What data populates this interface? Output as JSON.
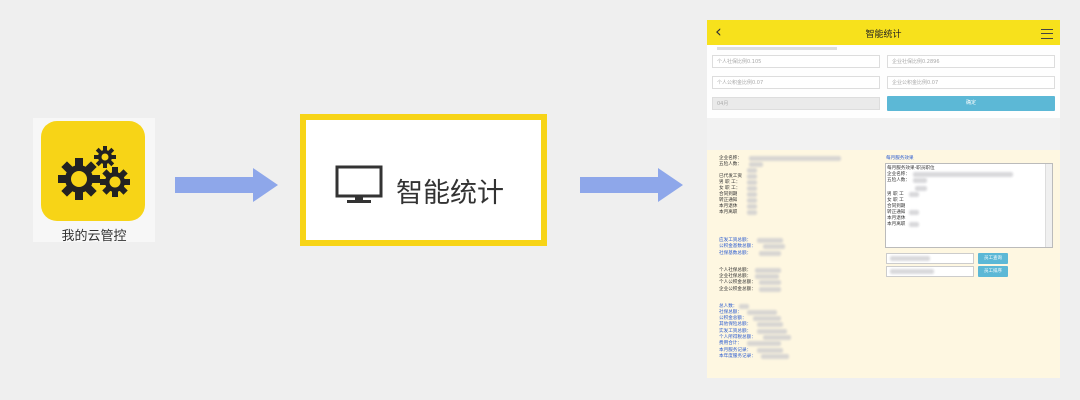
{
  "app": {
    "label": "我的云管控",
    "colors": {
      "icon_bg": "#f7d417",
      "gear": "#222222"
    }
  },
  "feature": {
    "label": "智能统计",
    "icon": "monitor-icon",
    "border_color": "#f7d417"
  },
  "arrows": {
    "color": "#8ea7ea"
  },
  "phone": {
    "title": "智能统计",
    "back": "‹",
    "inputs": {
      "personal_social": "个人社保比例0.105",
      "company_social": "企业社保比例0.2896",
      "personal_fund": "个人公积金比例0.07",
      "company_fund": "企业公积金比例0.07",
      "month": "04月"
    },
    "confirm_label": "确定",
    "header_color": "#f7e11c",
    "button_color": "#5cb8d6",
    "stats_left": {
      "group1": [
        "企业名称：",
        "五险人数：",
        "",
        "已代发工资",
        "男 职 工：",
        "女 职 工：",
        "合同到期",
        "转正通知",
        "本月退休",
        "本月离职"
      ],
      "group2": [
        "应发工资总额：",
        "公积金基数总额：",
        "社保基数总额："
      ],
      "group3": [
        "个人社保总额：",
        "企业社保总额：",
        "个人公积金总额：",
        "企业公积金总额："
      ],
      "group4": [
        "总人数：",
        "社保总额：",
        "公积金总额：",
        "其他保险总额：",
        "实发工资总额：",
        "个人所得税总额：",
        "费用合计：",
        "本月服务记录：",
        "本年度服务记录："
      ]
    },
    "stats_right": {
      "heading": "每月服务效果",
      "lines": [
        "每月服务效果-职员职位",
        "企业名称：",
        "五险人数：",
        "",
        "男 职 工",
        "女 职 工",
        "合同到期",
        "转正通知",
        "本月退休",
        "本月离职"
      ],
      "buttons": [
        "员工查询",
        "员工排序"
      ]
    }
  }
}
